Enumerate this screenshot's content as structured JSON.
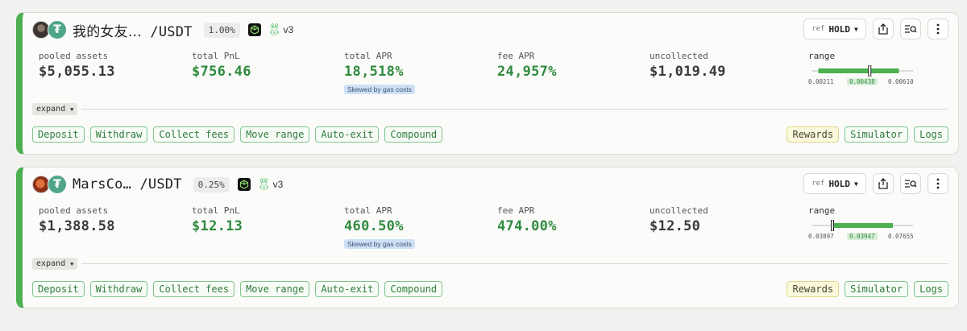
{
  "positions": [
    {
      "pair_token": "我的女友…",
      "pair_quote": " /USDT",
      "fee_tier": "1.00%",
      "version": "v3",
      "ref_label": "ref",
      "ref_value": "HOLD",
      "metrics": {
        "pooled_label": "pooled assets",
        "pooled_value": "$5,055.13",
        "pnl_label": "total PnL",
        "pnl_value": "$756.46",
        "apr_label": "total APR",
        "apr_value": "18,518%",
        "apr_note": "Skewed by gas costs",
        "fee_label": "fee APR",
        "fee_value": "24,957%",
        "unc_label": "uncollected",
        "unc_value": "$1,019.49"
      },
      "range": {
        "label": "range",
        "min": "0.00211",
        "current": "0.00438",
        "max": "0.00610",
        "current_pos": 0.57,
        "band_start": 0.06,
        "band_end": 0.86
      },
      "expand_label": "expand",
      "actions": [
        "Deposit",
        "Withdraw",
        "Collect fees",
        "Move range",
        "Auto-exit",
        "Compound"
      ],
      "actions_right": [
        "Rewards",
        "Simulator",
        "Logs"
      ]
    },
    {
      "pair_token": "MarsCo…",
      "pair_quote": " /USDT",
      "fee_tier": "0.25%",
      "version": "v3",
      "ref_label": "ref",
      "ref_value": "HOLD",
      "metrics": {
        "pooled_label": "pooled assets",
        "pooled_value": "$1,388.58",
        "pnl_label": "total PnL",
        "pnl_value": "$12.13",
        "apr_label": "total APR",
        "apr_value": "460.50%",
        "apr_note": "Skewed by gas costs",
        "fee_label": "fee APR",
        "fee_value": "474.00%",
        "unc_label": "uncollected",
        "unc_value": "$12.50"
      },
      "range": {
        "label": "range",
        "min": "0.03897",
        "current": "0.03947",
        "max": "0.07655",
        "current_pos": 0.2,
        "band_start": 0.2,
        "band_end": 0.8
      },
      "expand_label": "expand",
      "actions": [
        "Deposit",
        "Withdraw",
        "Collect fees",
        "Move range",
        "Auto-exit",
        "Compound"
      ],
      "actions_right": [
        "Rewards",
        "Simulator",
        "Logs"
      ]
    }
  ],
  "colors": {
    "accent": "#4caf50",
    "value_green": "#2f8a3e",
    "note_blue": "#cfe0f5",
    "rewards_yellow": "#fbf9dc"
  }
}
